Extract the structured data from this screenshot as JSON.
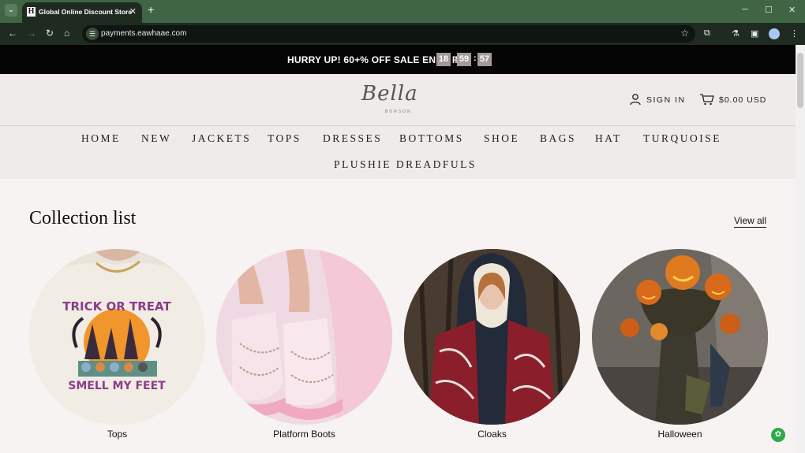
{
  "browser": {
    "tab_title": "Global Online Discount Store",
    "favicon_letter": "H",
    "url": "payments.eawhaae.com"
  },
  "announcement": {
    "text": "HURRY UP! 60+% OFF SALE ENDS IN",
    "hours": "18",
    "minutes": "59",
    "seconds": "57",
    "separator": ":"
  },
  "header": {
    "logo_script": "Bella",
    "logo_sub": "BORSON",
    "sign_in": "SIGN IN",
    "cart": "$0.00 USD"
  },
  "menu": [
    "HOME",
    "NEW",
    "JACKETS",
    "TOPS",
    "DRESSES",
    "BOTTOMS",
    "SHOE",
    "BAGS",
    "HAT",
    "TURQUOISE",
    "PLUSHIE DREADFULS"
  ],
  "collection": {
    "title": "Collection list",
    "view_all": "View all",
    "items": [
      {
        "label": "Tops",
        "image_text_1": "TRICK OR TREAT",
        "image_text_2": "SMELL MY FEET"
      },
      {
        "label": "Platform Boots"
      },
      {
        "label": "Cloaks"
      },
      {
        "label": "Halloween"
      }
    ]
  },
  "colors": {
    "tabbar": "#3f6545",
    "toolbar": "#1f2a21",
    "announce_bg": "#050505",
    "timer_box": "#a39a98",
    "header_bg": "#eeebea",
    "page_bg": "#f6f3f2"
  }
}
